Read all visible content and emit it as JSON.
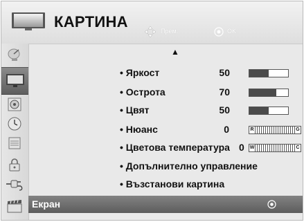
{
  "header": {
    "title": "КАРТИНА",
    "hint_move": "Прем.",
    "hint_ok": "OK",
    "move_icon": "four-direction-arrows-icon",
    "ok_icon": "ok-button-icon"
  },
  "sidebar": {
    "items": [
      {
        "icon": "satellite-dish-icon",
        "active": false
      },
      {
        "icon": "tv-screen-icon",
        "active": true
      },
      {
        "icon": "speaker-icon",
        "active": false
      },
      {
        "icon": "clock-icon",
        "active": false
      },
      {
        "icon": "options-icon",
        "active": false
      },
      {
        "icon": "lock-icon",
        "active": false
      },
      {
        "icon": "input-plug-icon",
        "active": false
      },
      {
        "icon": "movie-clapper-icon",
        "active": false
      }
    ]
  },
  "menu": {
    "up_arrow": "▲",
    "items": [
      {
        "label": "• Яркост",
        "value": "50",
        "type": "bar",
        "level": 0.5
      },
      {
        "label": "• Острота",
        "value": "70",
        "type": "bar",
        "level": 0.7
      },
      {
        "label": "• Цвят",
        "value": "50",
        "type": "bar",
        "level": 0.5
      },
      {
        "label": "• Нюанс",
        "value": "0",
        "type": "balance",
        "left": "R",
        "right": "G"
      },
      {
        "label": "• Цветова температура",
        "value": "0",
        "type": "balance",
        "left": "W",
        "right": "C"
      },
      {
        "label": "• Допълнително управление",
        "type": "none"
      },
      {
        "label": "• Възстанови картина",
        "type": "none"
      }
    ],
    "selected": {
      "label": "Екран",
      "icon": "ok-button-icon"
    }
  },
  "colors": {
    "background": "#e9e9e9",
    "selection": "#6e6e6e",
    "bar_fill": "#4b4b4b"
  }
}
